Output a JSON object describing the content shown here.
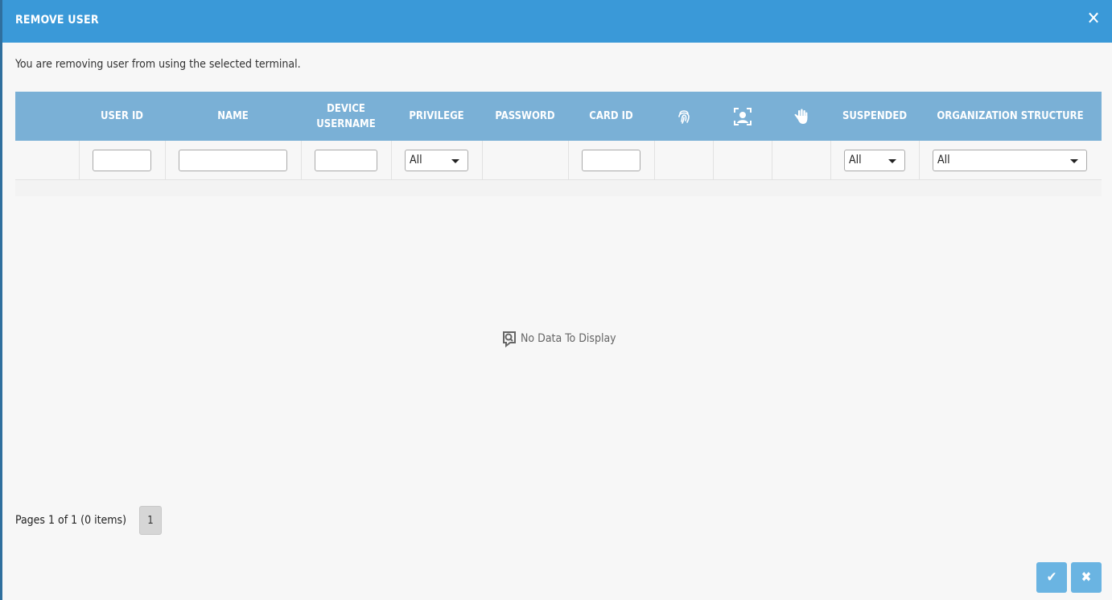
{
  "dialog": {
    "title": "REMOVE USER",
    "close_glyph": "✕",
    "description": "You are removing user from using the selected terminal."
  },
  "grid": {
    "columns": [
      {
        "key": "select",
        "label": ""
      },
      {
        "key": "user_id",
        "label": "USER ID"
      },
      {
        "key": "name",
        "label": "NAME"
      },
      {
        "key": "device_username",
        "label": "DEVICE\nUSERNAME"
      },
      {
        "key": "privilege",
        "label": "PRIVILEGE"
      },
      {
        "key": "password",
        "label": "PASSWORD"
      },
      {
        "key": "card_id",
        "label": "CARD ID"
      },
      {
        "key": "fingerprint",
        "label": "",
        "icon": "fingerprint-icon"
      },
      {
        "key": "face",
        "label": "",
        "icon": "face-icon"
      },
      {
        "key": "palm",
        "label": "",
        "icon": "palm-icon"
      },
      {
        "key": "suspended",
        "label": "SUSPENDED"
      },
      {
        "key": "organization_structure",
        "label": "ORGANIZATION STRUCTURE"
      }
    ],
    "filters": {
      "privilege": "All",
      "suspended": "All",
      "organization_structure": "All"
    },
    "empty_text": "No Data To Display"
  },
  "pager": {
    "summary": "Pages 1 of 1 (0 items)",
    "current_page": "1"
  },
  "footer": {
    "ok_glyph": "✔",
    "cancel_glyph": "✖"
  },
  "colors": {
    "titlebar": "#3a99d8",
    "header": "#7ab0d6",
    "button": "#6ab4e2"
  }
}
